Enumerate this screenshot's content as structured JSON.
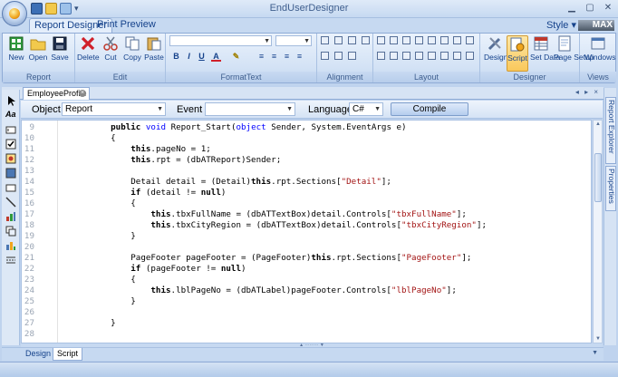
{
  "window": {
    "title": "EndUserDesigner"
  },
  "ribbon_tabs": [
    {
      "label": "Report Designer",
      "active": true
    },
    {
      "label": "Print Preview",
      "active": false
    }
  ],
  "style_menu": "Style",
  "style_arrow": "▾",
  "max_badge": "MAX",
  "ribbon": {
    "report_group": {
      "label": "Report",
      "buttons": [
        "New",
        "Open",
        "Save"
      ]
    },
    "edit_group": {
      "label": "Edit",
      "buttons": [
        "Delete",
        "Cut",
        "Copy",
        "Paste"
      ]
    },
    "format_group": {
      "label": "FormatText",
      "bold": "B",
      "italic": "I",
      "underline": "U",
      "fontcolor": "A"
    },
    "alignment_group": {
      "label": "Alignment"
    },
    "layout_group": {
      "label": "Layout"
    },
    "designer_group": {
      "label": "Designer",
      "buttons": [
        "Design",
        "Script",
        "Set Data",
        "Page Setup"
      ]
    },
    "views_group": {
      "label": "Views",
      "buttons": [
        "Windows"
      ]
    }
  },
  "document_tab": {
    "label": "EmployeeProfile",
    "close": "×"
  },
  "doc_nav": "◂ ▸ ×",
  "scriptbar": {
    "object_label": "Object :",
    "object_value": "Report",
    "event_label": "Event :",
    "event_value": "",
    "language_label": "Language :",
    "language_value": "C#",
    "compile_label": "Compile"
  },
  "code_lines": [
    {
      "n": "9",
      "segments": [
        {
          "t": "    "
        },
        {
          "t": "public",
          "c": "kb"
        },
        {
          "t": " "
        },
        {
          "t": "void",
          "c": "kw"
        },
        {
          "t": " Report_Start("
        },
        {
          "t": "object",
          "c": "kw"
        },
        {
          "t": " Sender, System.EventArgs e)"
        }
      ]
    },
    {
      "n": "10",
      "segments": [
        {
          "t": "    {"
        }
      ]
    },
    {
      "n": "11",
      "segments": [
        {
          "t": "        "
        },
        {
          "t": "this",
          "c": "kb"
        },
        {
          "t": ".pageNo = 1;"
        }
      ]
    },
    {
      "n": "12",
      "segments": [
        {
          "t": "        "
        },
        {
          "t": "this",
          "c": "kb"
        },
        {
          "t": ".rpt = (dbATReport)Sender;"
        }
      ]
    },
    {
      "n": "13",
      "segments": [
        {
          "t": ""
        }
      ]
    },
    {
      "n": "14",
      "segments": [
        {
          "t": "        Detail detail = (Detail)"
        },
        {
          "t": "this",
          "c": "kb"
        },
        {
          "t": ".rpt.Sections["
        },
        {
          "t": "\"Detail\"",
          "c": "str"
        },
        {
          "t": "];"
        }
      ]
    },
    {
      "n": "15",
      "segments": [
        {
          "t": "        "
        },
        {
          "t": "if",
          "c": "kb"
        },
        {
          "t": " (detail != "
        },
        {
          "t": "null",
          "c": "kb"
        },
        {
          "t": ")"
        }
      ]
    },
    {
      "n": "16",
      "segments": [
        {
          "t": "        {"
        }
      ]
    },
    {
      "n": "17",
      "segments": [
        {
          "t": "            "
        },
        {
          "t": "this",
          "c": "kb"
        },
        {
          "t": ".tbxFullName = (dbATTextBox)detail.Controls["
        },
        {
          "t": "\"tbxFullName\"",
          "c": "str"
        },
        {
          "t": "];"
        }
      ]
    },
    {
      "n": "18",
      "segments": [
        {
          "t": "            "
        },
        {
          "t": "this",
          "c": "kb"
        },
        {
          "t": ".tbxCityRegion = (dbATTextBox)detail.Controls["
        },
        {
          "t": "\"tbxCityRegion\"",
          "c": "str"
        },
        {
          "t": "];"
        }
      ]
    },
    {
      "n": "19",
      "segments": [
        {
          "t": "        }"
        }
      ]
    },
    {
      "n": "20",
      "segments": [
        {
          "t": ""
        }
      ]
    },
    {
      "n": "21",
      "segments": [
        {
          "t": "        PageFooter pageFooter = (PageFooter)"
        },
        {
          "t": "this",
          "c": "kb"
        },
        {
          "t": ".rpt.Sections["
        },
        {
          "t": "\"PageFooter\"",
          "c": "str"
        },
        {
          "t": "];"
        }
      ]
    },
    {
      "n": "22",
      "segments": [
        {
          "t": "        "
        },
        {
          "t": "if",
          "c": "kb"
        },
        {
          "t": " (pageFooter != "
        },
        {
          "t": "null",
          "c": "kb"
        },
        {
          "t": ")"
        }
      ]
    },
    {
      "n": "23",
      "segments": [
        {
          "t": "        {"
        }
      ]
    },
    {
      "n": "24",
      "segments": [
        {
          "t": "            "
        },
        {
          "t": "this",
          "c": "kb"
        },
        {
          "t": ".lblPageNo = (dbATLabel)pageFooter.Controls["
        },
        {
          "t": "\"lblPageNo\"",
          "c": "str"
        },
        {
          "t": "];"
        }
      ]
    },
    {
      "n": "25",
      "segments": [
        {
          "t": "        }"
        }
      ]
    },
    {
      "n": "26",
      "segments": [
        {
          "t": ""
        }
      ]
    },
    {
      "n": "27",
      "segments": [
        {
          "t": "    }"
        }
      ]
    },
    {
      "n": "28",
      "segments": [
        {
          "t": ""
        }
      ]
    }
  ],
  "right_panels": [
    "Report Explorer",
    "Properties"
  ],
  "bottom_tabs": [
    {
      "label": "Design",
      "active": false
    },
    {
      "label": "Script",
      "active": true
    }
  ],
  "colors": {
    "accent": "#15428b",
    "keyword": "#0000ff",
    "string": "#a31515",
    "ribbon_bg": "#d3e2f5"
  }
}
